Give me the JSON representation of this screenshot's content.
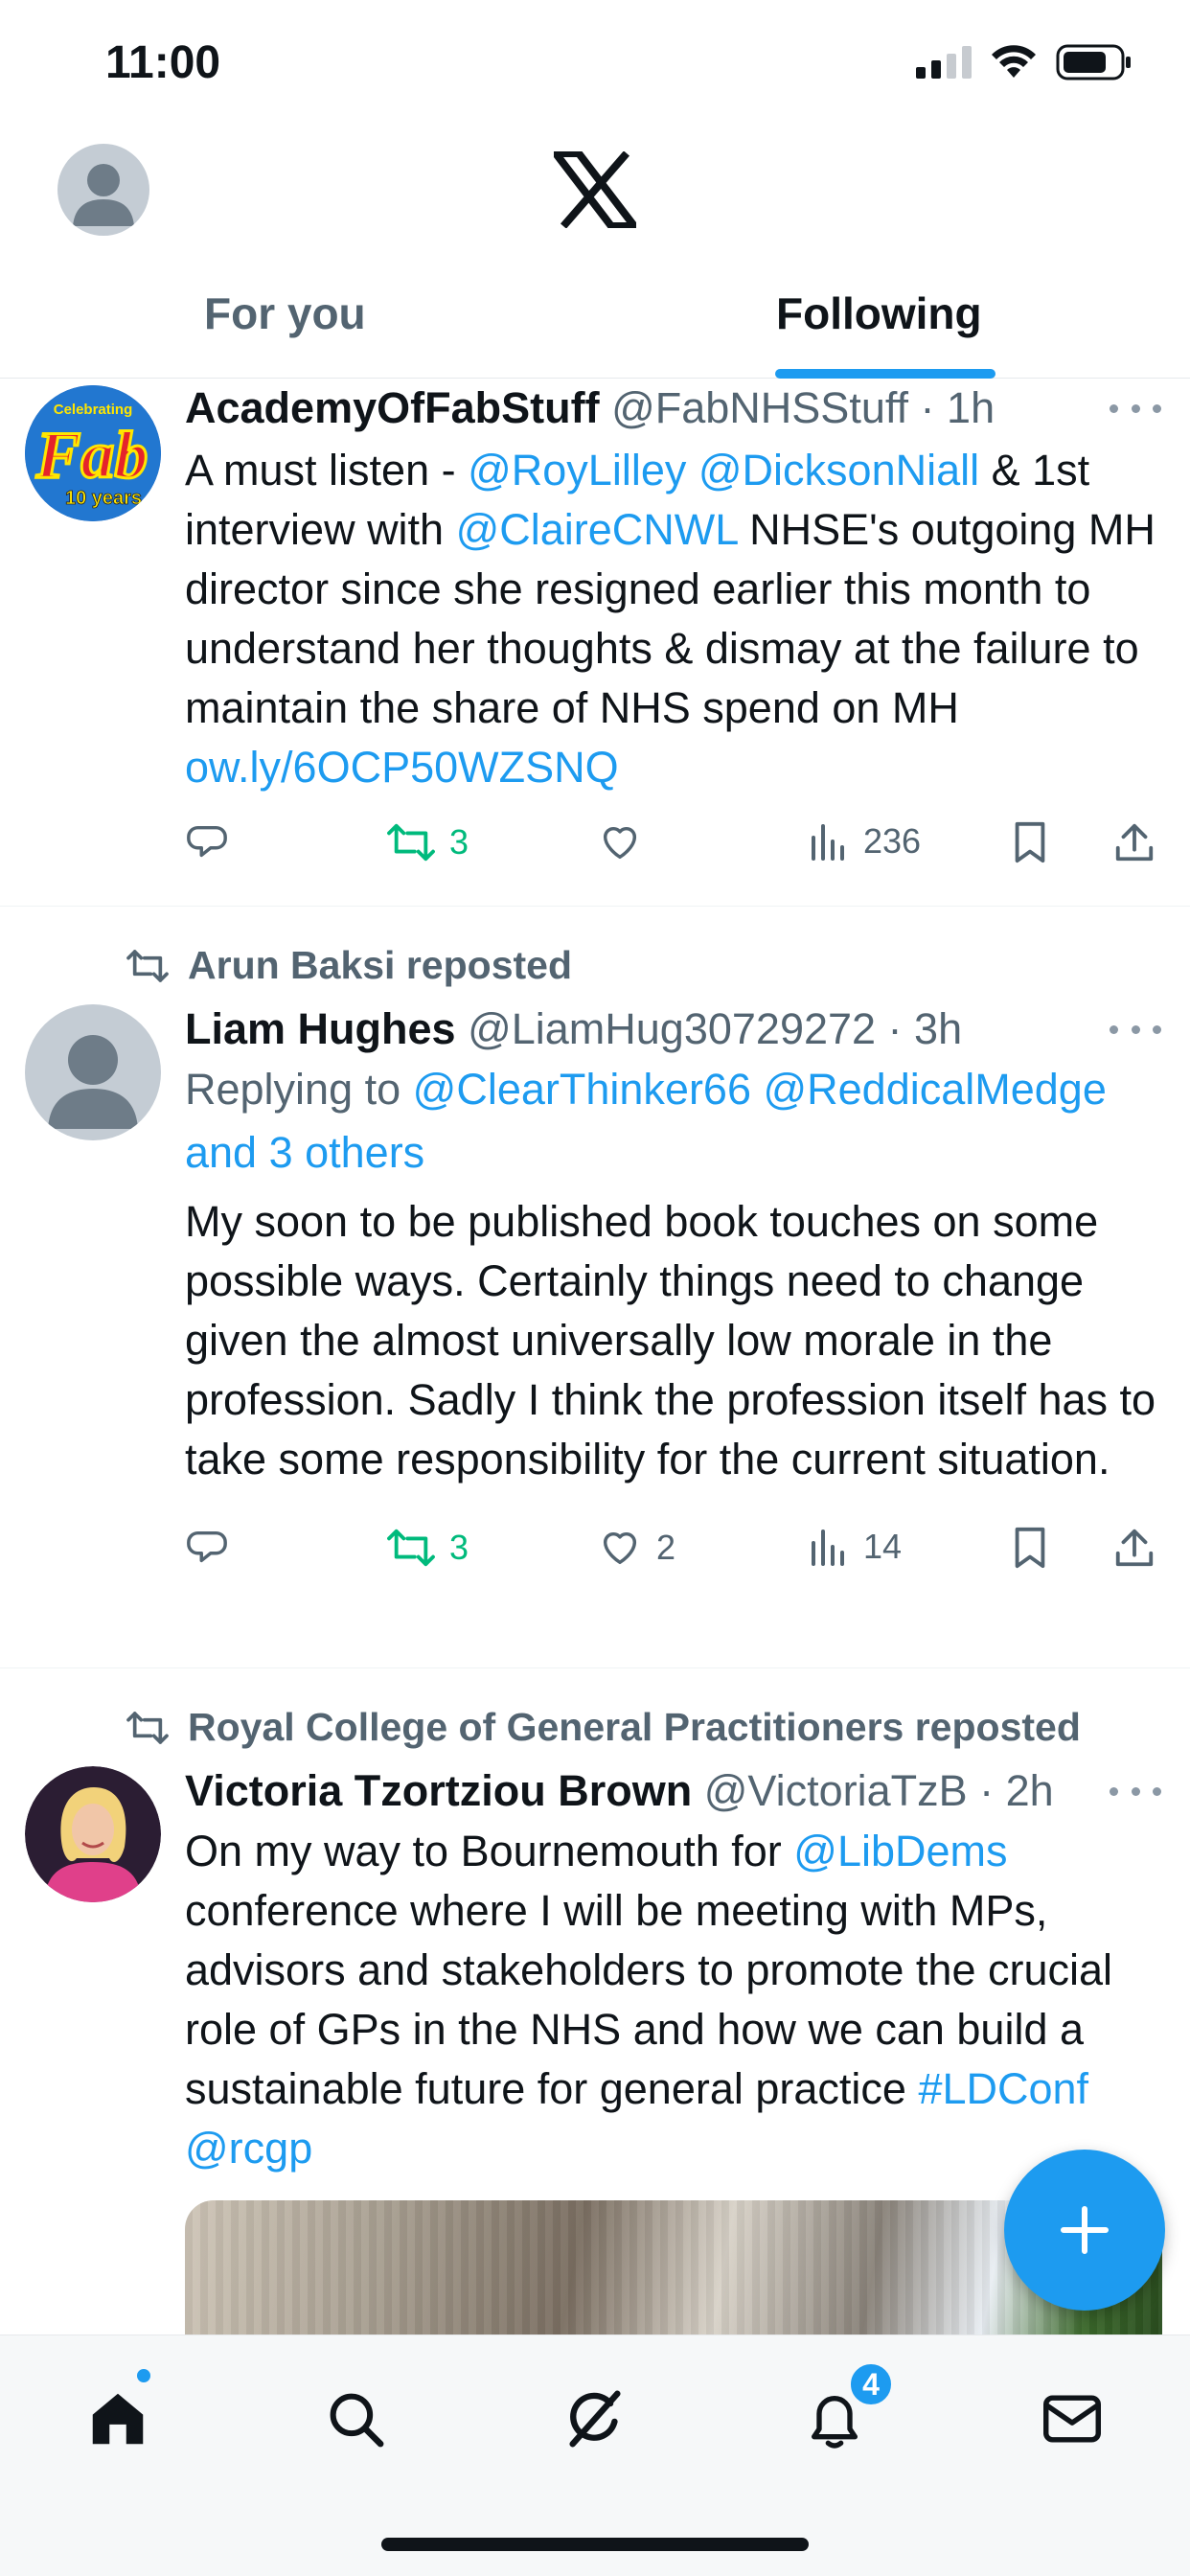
{
  "status_bar": {
    "time": "11:00"
  },
  "header": {
    "tabs": [
      {
        "label": "For you"
      },
      {
        "label": "Following"
      }
    ]
  },
  "tweets": [
    {
      "name": "AcademyOfFabStuff",
      "handle": "@FabNHSStuff",
      "time": "1h",
      "text_parts": [
        {
          "t": "A must listen - "
        },
        {
          "t": "@RoyLilley",
          "link": true
        },
        {
          "t": " "
        },
        {
          "t": "@DicksonNiall",
          "link": true
        },
        {
          "t": " & 1st interview with "
        },
        {
          "t": "@ClaireCNWL",
          "link": true
        },
        {
          "t": " NHSE's outgoing MH director since she resigned earlier this month to understand her thoughts & dismay at the failure  to maintain the share of NHS spend on MH  "
        },
        {
          "t": "ow.ly/6OCP50WZSNQ",
          "link": true
        }
      ],
      "avatar_text": {
        "top": "Celebrating",
        "middle": "Fab",
        "bottom": "10 years"
      },
      "reposts": "3",
      "likes": "",
      "views": "236"
    },
    {
      "reposted_by": "Arun Baksi reposted",
      "name": "Liam Hughes",
      "handle": "@LiamHug30729272",
      "time": "3h",
      "replying_label": "Replying to",
      "replying_to": "@ClearThinker66 @ReddicalMedge",
      "replying_more": "and 3 others",
      "text": "My soon to be published book touches on some possible ways. Certainly things need to change given the almost universally low morale in the profession. Sadly I think the profession itself has to take some responsibility for the current situation.",
      "reposts": "3",
      "likes": "2",
      "views": "14"
    },
    {
      "reposted_by": "Royal College of General Practitioners reposted",
      "name": "Victoria Tzortziou Brown",
      "handle": "@VictoriaTzB",
      "time": "2h",
      "text_parts": [
        {
          "t": "On my way to Bournemouth for "
        },
        {
          "t": "@LibDems",
          "link": true
        },
        {
          "t": " conference where I will be meeting with MPs, advisors and stakeholders to promote the crucial role of GPs in the NHS and how we can build a sustainable future for general practice "
        },
        {
          "t": "#LDConf",
          "link": true
        },
        {
          "t": " "
        },
        {
          "t": "@rcgp",
          "link": true
        }
      ]
    }
  ],
  "bottom_nav": {
    "notifications_badge": "4"
  },
  "colors": {
    "accent": "#1d9bf0",
    "repost_green": "#00ba7c",
    "muted": "#536471"
  }
}
